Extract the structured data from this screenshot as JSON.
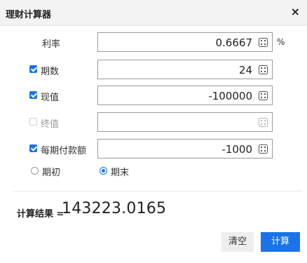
{
  "dialog": {
    "title": "理财计算器",
    "close_symbol": "×"
  },
  "fields": [
    {
      "label": "利率",
      "value": "0.6667",
      "unit": "%",
      "has_checkbox": false,
      "checked": null,
      "disabled": false
    },
    {
      "label": "期数",
      "value": "24",
      "has_checkbox": true,
      "checked": true,
      "disabled": false
    },
    {
      "label": "现值",
      "value": "-100000",
      "has_checkbox": true,
      "checked": true,
      "disabled": false
    },
    {
      "label": "终值",
      "value": "",
      "has_checkbox": true,
      "checked": false,
      "disabled": true
    },
    {
      "label": "每期付款额",
      "value": "-1000",
      "has_checkbox": true,
      "checked": true,
      "disabled": false
    }
  ],
  "payment_timing": {
    "options": [
      {
        "label": "期初",
        "selected": false
      },
      {
        "label": "期末",
        "selected": true
      }
    ]
  },
  "result": {
    "label": "计算结果 =",
    "value": "143223.0165"
  },
  "buttons": {
    "clear": "清空",
    "calculate": "计算"
  },
  "icons": {
    "calculator": "calculator-icon",
    "close": "close-icon"
  },
  "colors": {
    "accent": "#1a73e8",
    "header_bg": "#f3f3f3",
    "field_border": "#9a9a9a",
    "disabled_text": "#9a9a9a"
  }
}
